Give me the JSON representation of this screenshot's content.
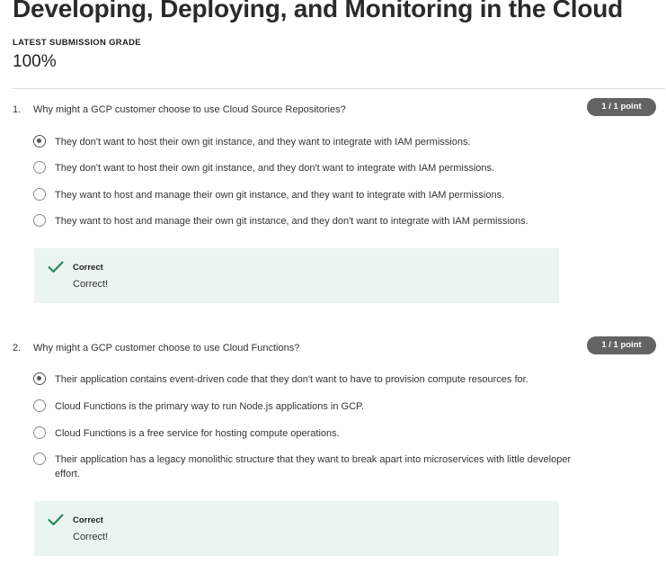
{
  "page": {
    "title": "Developing, Deploying, and Monitoring in the Cloud",
    "grade_label": "LATEST SUBMISSION GRADE",
    "grade_value": "100%"
  },
  "colors": {
    "badge_bg": "#636363",
    "feedback_bg": "#eaf5f2",
    "check_green": "#1f8354"
  },
  "questions": [
    {
      "number": "1.",
      "prompt": "Why might a GCP customer choose to use Cloud Source Repositories?",
      "points": "1 / 1 point",
      "options": [
        {
          "text": "They don't want to host their own git instance, and they want to integrate with IAM permissions.",
          "selected": true
        },
        {
          "text": "They don't want to host their own git instance, and they don't want to integrate with IAM permissions.",
          "selected": false
        },
        {
          "text": "They want to host and manage their own git instance, and they want to integrate with IAM permissions.",
          "selected": false
        },
        {
          "text": "They want to host and manage their own git instance, and they don't want to integrate with IAM permissions.",
          "selected": false
        }
      ],
      "feedback": {
        "icon": "check-icon",
        "label": "Correct",
        "message": "Correct!"
      }
    },
    {
      "number": "2.",
      "prompt": "Why might a GCP customer choose to use Cloud Functions?",
      "points": "1 / 1 point",
      "options": [
        {
          "text": "Their application contains event-driven code that they don't want to have to provision compute resources for.",
          "selected": true
        },
        {
          "text": "Cloud Functions is the primary way to run Node.js applications in GCP.",
          "selected": false
        },
        {
          "text": "Cloud Functions is a free service for hosting compute operations.",
          "selected": false
        },
        {
          "text": "Their application has a legacy monolithic structure that they want to break apart into microservices with little developer effort.",
          "selected": false
        }
      ],
      "feedback": {
        "icon": "check-icon",
        "label": "Correct",
        "message": "Correct!"
      }
    }
  ]
}
